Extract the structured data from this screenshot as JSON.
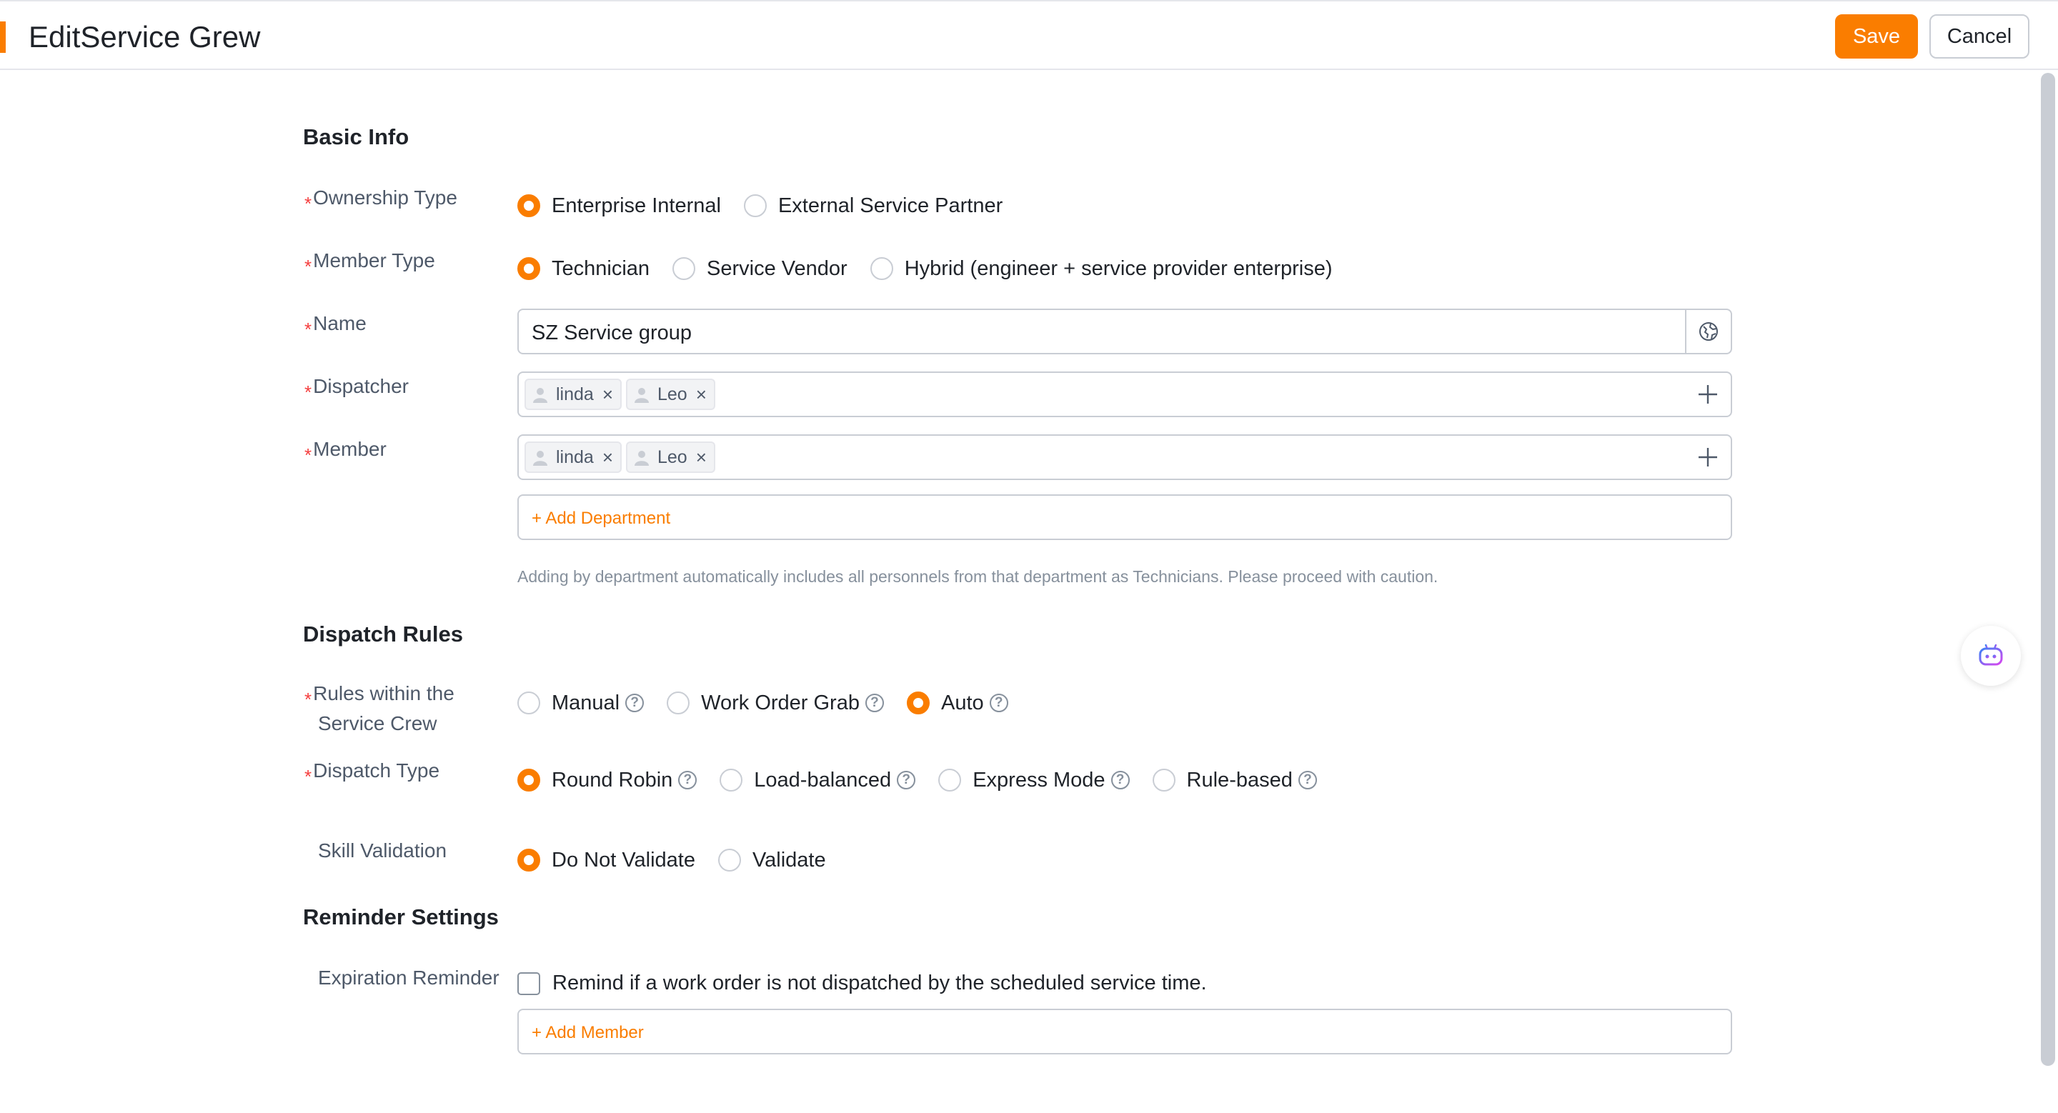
{
  "header": {
    "title": "EditService Grew",
    "save_label": "Save",
    "cancel_label": "Cancel",
    "accent_color": "#fa7d00"
  },
  "basic_info": {
    "title": "Basic Info",
    "ownership_type": {
      "label": "Ownership Type",
      "options": [
        "Enterprise Internal",
        "External Service Partner"
      ],
      "selected": "Enterprise Internal"
    },
    "member_type": {
      "label": "Member Type",
      "options": [
        "Technician",
        "Service Vendor",
        "Hybrid (engineer + service provider enterprise)"
      ],
      "selected": "Technician"
    },
    "name": {
      "label": "Name",
      "value": "SZ Service group",
      "icon": "globe-icon"
    },
    "dispatcher": {
      "label": "Dispatcher",
      "tags": [
        "linda",
        "Leo"
      ]
    },
    "member": {
      "label": "Member",
      "tags": [
        "linda",
        "Leo"
      ],
      "add_department": "+ Add Department",
      "hint": "Adding by department automatically includes all personnels from that department as Technicians. Please proceed with caution."
    }
  },
  "dispatch_rules": {
    "title": "Dispatch Rules",
    "rules_within": {
      "label_line1": "Rules within the",
      "label_line2": "Service Crew",
      "options": [
        "Manual",
        "Work Order Grab",
        "Auto"
      ],
      "selected": "Auto"
    },
    "dispatch_type": {
      "label": "Dispatch Type",
      "options": [
        "Round Robin",
        "Load-balanced",
        "Express Mode",
        "Rule-based"
      ],
      "selected": "Round Robin"
    },
    "skill_validation": {
      "label": "Skill Validation",
      "options": [
        "Do Not Validate",
        "Validate"
      ],
      "selected": "Do Not Validate"
    }
  },
  "reminder_settings": {
    "title": "Reminder Settings",
    "expiration_reminder": {
      "label": "Expiration Reminder",
      "checkbox_label": "Remind if a work order is not dispatched by the scheduled service time.",
      "checked": false,
      "add_member": "+ Add Member"
    }
  },
  "help_glyph": "?",
  "remove_glyph": "×",
  "required_mark": "*"
}
